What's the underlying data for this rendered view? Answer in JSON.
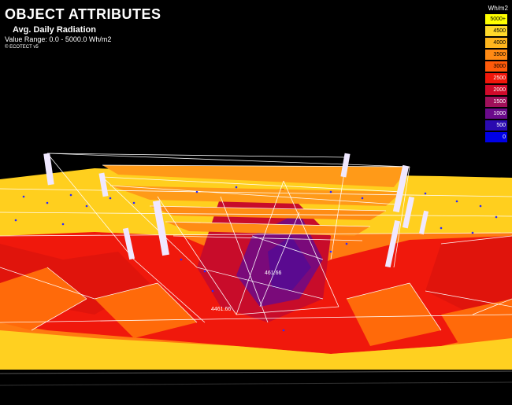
{
  "header": {
    "title": "OBJECT ATTRIBUTES",
    "subtitle": "Avg. Daily Radiation",
    "value_range": "Value Range: 0.0 - 5000.0 Wh/m2",
    "credit": "© ECOTECT v5"
  },
  "legend": {
    "unit": "Wh/m2",
    "items": [
      {
        "label": "5000+",
        "color": "#ffff00",
        "text_color": "#000000"
      },
      {
        "label": "4500",
        "color": "#ffd92a",
        "text_color": "#000000"
      },
      {
        "label": "4000",
        "color": "#ffb61e",
        "text_color": "#000000"
      },
      {
        "label": "3500",
        "color": "#ff8a14",
        "text_color": "#000000"
      },
      {
        "label": "3000",
        "color": "#ff5a0a",
        "text_color": "#000000"
      },
      {
        "label": "2500",
        "color": "#f0160a",
        "text_color": "#ffffff"
      },
      {
        "label": "2000",
        "color": "#d00a2a",
        "text_color": "#ffffff"
      },
      {
        "label": "1500",
        "color": "#a0105a",
        "text_color": "#ffffff"
      },
      {
        "label": "1000",
        "color": "#6a0a8a",
        "text_color": "#ffffff"
      },
      {
        "label": "500",
        "color": "#2a0ab0",
        "text_color": "#ffffff"
      },
      {
        "label": "0",
        "color": "#0000e6",
        "text_color": "#ffffff"
      }
    ]
  },
  "annotations": [
    {
      "label": "461.66"
    },
    {
      "label": "4461.66"
    }
  ],
  "colors": {
    "background": "#000000",
    "wireframe": "#ffffff",
    "node_marker": "#2a2aff"
  }
}
